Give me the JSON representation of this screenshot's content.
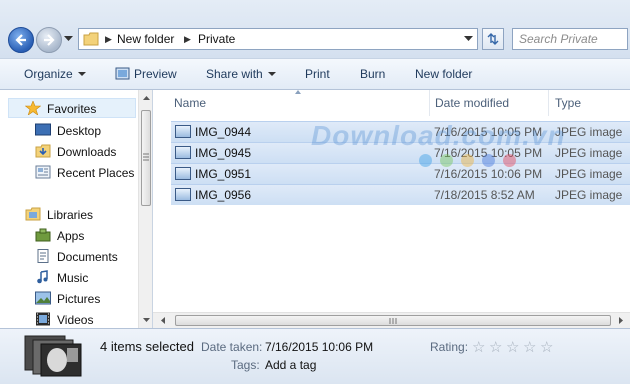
{
  "address": {
    "crumbs": [
      "New folder",
      "Private"
    ],
    "search_placeholder": "Search Private"
  },
  "toolbar": {
    "organize": "Organize",
    "preview": "Preview",
    "share_with": "Share with",
    "print": "Print",
    "burn": "Burn",
    "new_folder": "New folder"
  },
  "nav": {
    "favorites": "Favorites",
    "desktop": "Desktop",
    "downloads": "Downloads",
    "recent_places": "Recent Places",
    "libraries": "Libraries",
    "apps": "Apps",
    "documents": "Documents",
    "music": "Music",
    "pictures": "Pictures",
    "videos": "Videos"
  },
  "columns": {
    "name": "Name",
    "date_modified": "Date modified",
    "type": "Type"
  },
  "files": [
    {
      "name": "IMG_0944",
      "date": "7/16/2015 10:05 PM",
      "type": "JPEG image"
    },
    {
      "name": "IMG_0945",
      "date": "7/16/2015 10:05 PM",
      "type": "JPEG image"
    },
    {
      "name": "IMG_0951",
      "date": "7/16/2015 10:06 PM",
      "type": "JPEG image"
    },
    {
      "name": "IMG_0956",
      "date": "7/18/2015 8:52 AM",
      "type": "JPEG image"
    }
  ],
  "watermark": "Download.com.vn",
  "details": {
    "selected": "4 items selected",
    "date_taken_label": "Date taken:",
    "date_taken_value": "7/16/2015 10:06 PM",
    "tags_label": "Tags:",
    "tags_value": "Add a tag",
    "rating_label": "Rating:",
    "rating_stars": 0,
    "rating_max": 5
  },
  "colors": {
    "selection": "#cddff4",
    "accent": "#1e395b"
  }
}
